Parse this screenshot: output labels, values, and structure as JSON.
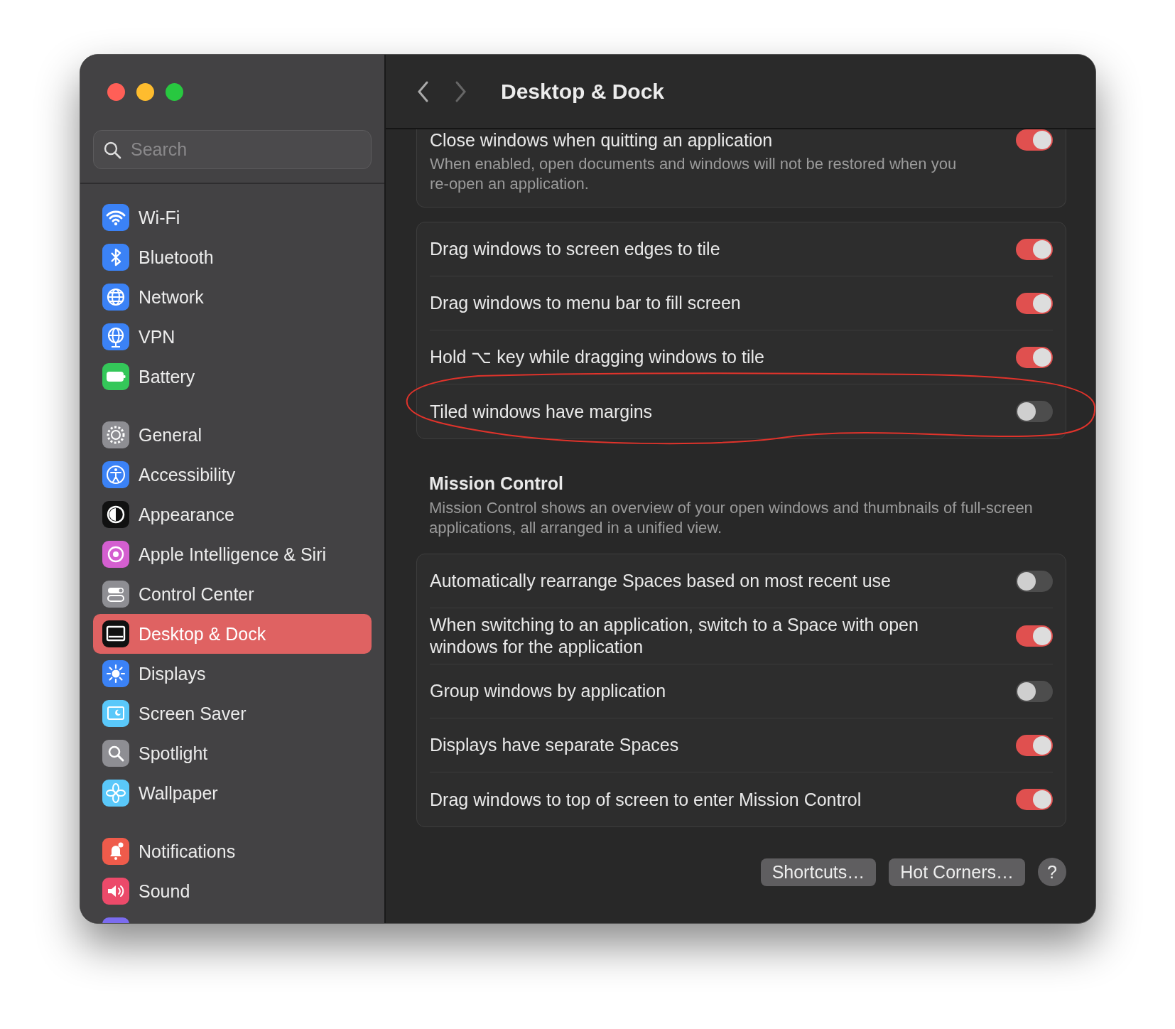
{
  "window": {
    "title": "Desktop & Dock"
  },
  "sidebar": {
    "search": {
      "placeholder": "Search"
    },
    "groups": [
      [
        {
          "kind": "wifi",
          "label": "Wi-Fi",
          "selected": false
        },
        {
          "kind": "bluetooth",
          "label": "Bluetooth",
          "selected": false
        },
        {
          "kind": "network",
          "label": "Network",
          "selected": false
        },
        {
          "kind": "vpn",
          "label": "VPN",
          "selected": false
        },
        {
          "kind": "battery",
          "label": "Battery",
          "selected": false
        }
      ],
      [
        {
          "kind": "general",
          "label": "General",
          "selected": false
        },
        {
          "kind": "accessibility",
          "label": "Accessibility",
          "selected": false
        },
        {
          "kind": "appearance",
          "label": "Appearance",
          "selected": false
        },
        {
          "kind": "siri",
          "label": "Apple Intelligence & Siri",
          "selected": false
        },
        {
          "kind": "control",
          "label": "Control Center",
          "selected": false
        },
        {
          "kind": "desktop",
          "label": "Desktop & Dock",
          "selected": true
        },
        {
          "kind": "displays",
          "label": "Displays",
          "selected": false
        },
        {
          "kind": "screensaver",
          "label": "Screen Saver",
          "selected": false
        },
        {
          "kind": "spotlight",
          "label": "Spotlight",
          "selected": false
        },
        {
          "kind": "wallpaper",
          "label": "Wallpaper",
          "selected": false
        }
      ],
      [
        {
          "kind": "notifications",
          "label": "Notifications",
          "selected": false
        },
        {
          "kind": "sound",
          "label": "Sound",
          "selected": false
        },
        {
          "kind": "focus",
          "selected": false
        }
      ]
    ]
  },
  "sections": [
    {
      "rows": [
        {
          "label": "Close windows when quitting an application",
          "description": "When enabled, open documents and windows will not be restored when you re-open an application.",
          "on": true
        }
      ]
    },
    {
      "rows": [
        {
          "label": "Drag windows to screen edges to tile",
          "on": true
        },
        {
          "label": "Drag windows to menu bar to fill screen",
          "on": true
        },
        {
          "label": "Hold ⌥ key while dragging windows to tile",
          "on": true
        },
        {
          "label": "Tiled windows have margins",
          "on": false
        }
      ]
    },
    {
      "heading": "Mission Control",
      "description": "Mission Control shows an overview of your open windows and thumbnails of full-screen applications, all arranged in a unified view.",
      "rows": [
        {
          "label": "Automatically rearrange Spaces based on most recent use",
          "on": false
        },
        {
          "label": "When switching to an application, switch to a Space with open windows for the application",
          "on": true
        },
        {
          "label": "Group windows by application",
          "on": false
        },
        {
          "label": "Displays have separate Spaces",
          "on": true
        },
        {
          "label": "Drag windows to top of screen to enter Mission Control",
          "on": true
        }
      ]
    }
  ],
  "buttons": [
    "Shortcuts…",
    "Hot Corners…"
  ],
  "help": "?"
}
